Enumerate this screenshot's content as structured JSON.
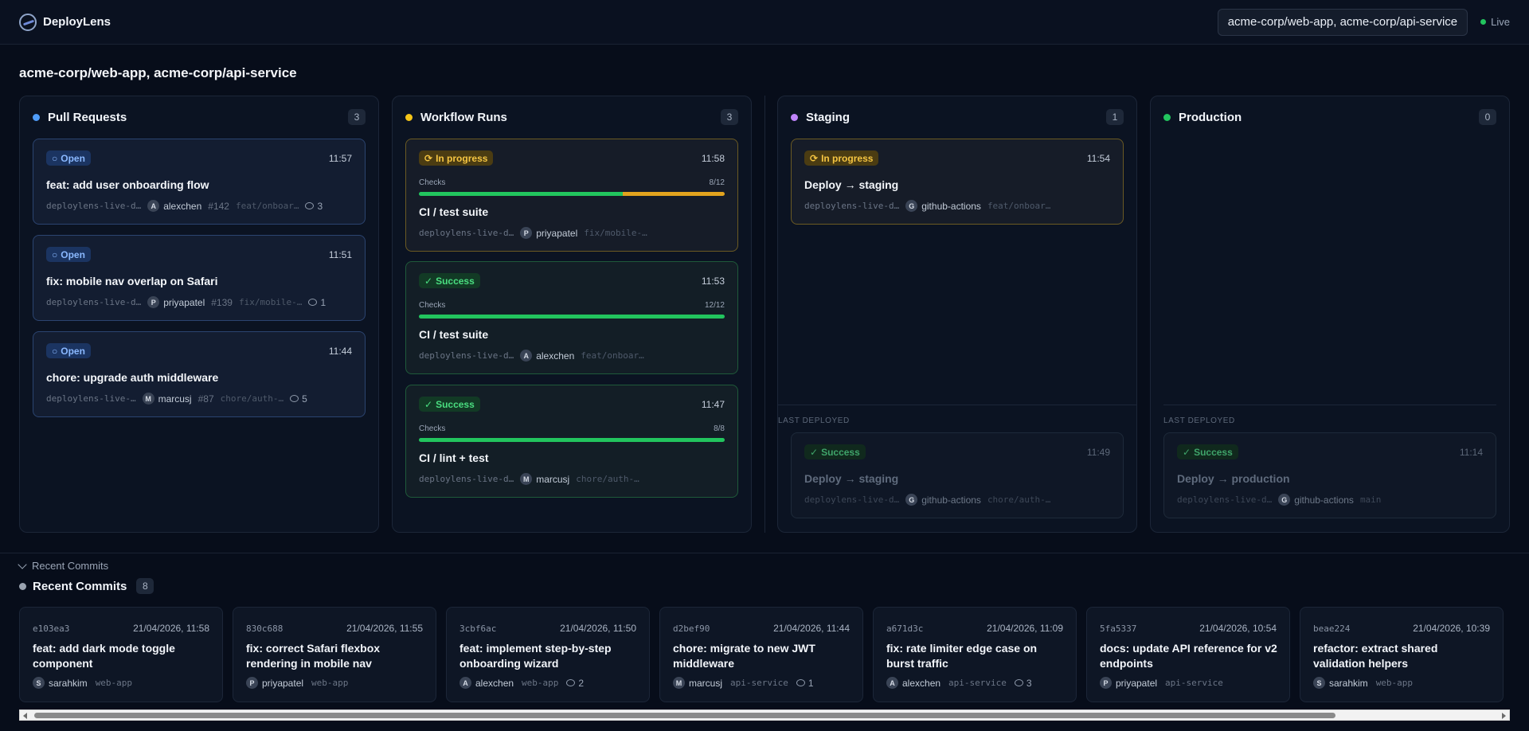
{
  "app": {
    "name": "DeployLens",
    "repos": "acme-corp/web-app, acme-corp/api-service",
    "live_label": "Live"
  },
  "page_title": "acme-corp/web-app, acme-corp/api-service",
  "colors": {
    "pr": "#4f9cf9",
    "runs": "#f5c518",
    "staging": "#c084fc",
    "production": "#22c55e"
  },
  "columns": {
    "prs": {
      "title": "Pull Requests",
      "count": "3",
      "cards": [
        {
          "status": "Open",
          "time": "11:57",
          "title": "feat: add user onboarding flow",
          "repo": "deploylens-live-d…",
          "avatar": "A",
          "user": "alexchen",
          "number": "#142",
          "branch": "feat/onboar…",
          "comments": "3"
        },
        {
          "status": "Open",
          "time": "11:51",
          "title": "fix: mobile nav overlap on Safari",
          "repo": "deploylens-live-d…",
          "avatar": "P",
          "user": "priyapatel",
          "number": "#139",
          "branch": "fix/mobile-…",
          "comments": "1"
        },
        {
          "status": "Open",
          "time": "11:44",
          "title": "chore: upgrade auth middleware",
          "repo": "deploylens-live-…",
          "avatar": "M",
          "user": "marcusj",
          "number": "#87",
          "branch": "chore/auth-…",
          "comments": "5"
        }
      ]
    },
    "runs": {
      "title": "Workflow Runs",
      "count": "3",
      "cards": [
        {
          "status": "In progress",
          "time": "11:58",
          "checks_label": "Checks",
          "checks": "8/12",
          "progress": 0.667,
          "title": "CI / test suite",
          "repo": "deploylens-live-d…",
          "avatar": "P",
          "user": "priyapatel",
          "branch": "fix/mobile-…"
        },
        {
          "status": "Success",
          "time": "11:53",
          "checks_label": "Checks",
          "checks": "12/12",
          "progress": 1.0,
          "title": "CI / test suite",
          "repo": "deploylens-live-d…",
          "avatar": "A",
          "user": "alexchen",
          "branch": "feat/onboar…"
        },
        {
          "status": "Success",
          "time": "11:47",
          "checks_label": "Checks",
          "checks": "8/8",
          "progress": 1.0,
          "title": "CI / lint + test",
          "repo": "deploylens-live-d…",
          "avatar": "M",
          "user": "marcusj",
          "branch": "chore/auth-…"
        }
      ]
    },
    "staging": {
      "title": "Staging",
      "count": "1",
      "active": {
        "status": "In progress",
        "time": "11:54",
        "title": "Deploy → staging",
        "repo": "deploylens-live-d…",
        "avatar": "G",
        "user": "github-actions",
        "branch": "feat/onboar…"
      },
      "last_label": "LAST DEPLOYED",
      "last": {
        "status": "Success",
        "time": "11:49",
        "title": "Deploy → staging",
        "repo": "deploylens-live-d…",
        "avatar": "G",
        "user": "github-actions",
        "branch": "chore/auth-…"
      }
    },
    "production": {
      "title": "Production",
      "count": "0",
      "last_label": "LAST DEPLOYED",
      "last": {
        "status": "Success",
        "time": "11:14",
        "title": "Deploy → production",
        "repo": "deploylens-live-d…",
        "avatar": "G",
        "user": "github-actions",
        "branch": "main"
      }
    }
  },
  "commits_section": {
    "toggle_label": "Recent Commits",
    "title": "Recent Commits",
    "count": "8",
    "items": [
      {
        "sha": "e103ea3",
        "date": "21/04/2026, 11:58",
        "title": "feat: add dark mode toggle component",
        "avatar": "S",
        "user": "sarahkim",
        "repo": "web-app",
        "comments": ""
      },
      {
        "sha": "830c688",
        "date": "21/04/2026, 11:55",
        "title": "fix: correct Safari flexbox rendering in mobile nav",
        "avatar": "P",
        "user": "priyapatel",
        "repo": "web-app",
        "comments": ""
      },
      {
        "sha": "3cbf6ac",
        "date": "21/04/2026, 11:50",
        "title": "feat: implement step-by-step onboarding wizard",
        "avatar": "A",
        "user": "alexchen",
        "repo": "web-app",
        "comments": "2"
      },
      {
        "sha": "d2bef90",
        "date": "21/04/2026, 11:44",
        "title": "chore: migrate to new JWT middleware",
        "avatar": "M",
        "user": "marcusj",
        "repo": "api-service",
        "comments": "1"
      },
      {
        "sha": "a671d3c",
        "date": "21/04/2026, 11:09",
        "title": "fix: rate limiter edge case on burst traffic",
        "avatar": "A",
        "user": "alexchen",
        "repo": "api-service",
        "comments": "3"
      },
      {
        "sha": "5fa5337",
        "date": "21/04/2026, 10:54",
        "title": "docs: update API reference for v2 endpoints",
        "avatar": "P",
        "user": "priyapatel",
        "repo": "api-service",
        "comments": ""
      },
      {
        "sha": "beae224",
        "date": "21/04/2026, 10:39",
        "title": "refactor: extract shared validation helpers",
        "avatar": "S",
        "user": "sarahkim",
        "repo": "web-app",
        "comments": ""
      }
    ]
  }
}
